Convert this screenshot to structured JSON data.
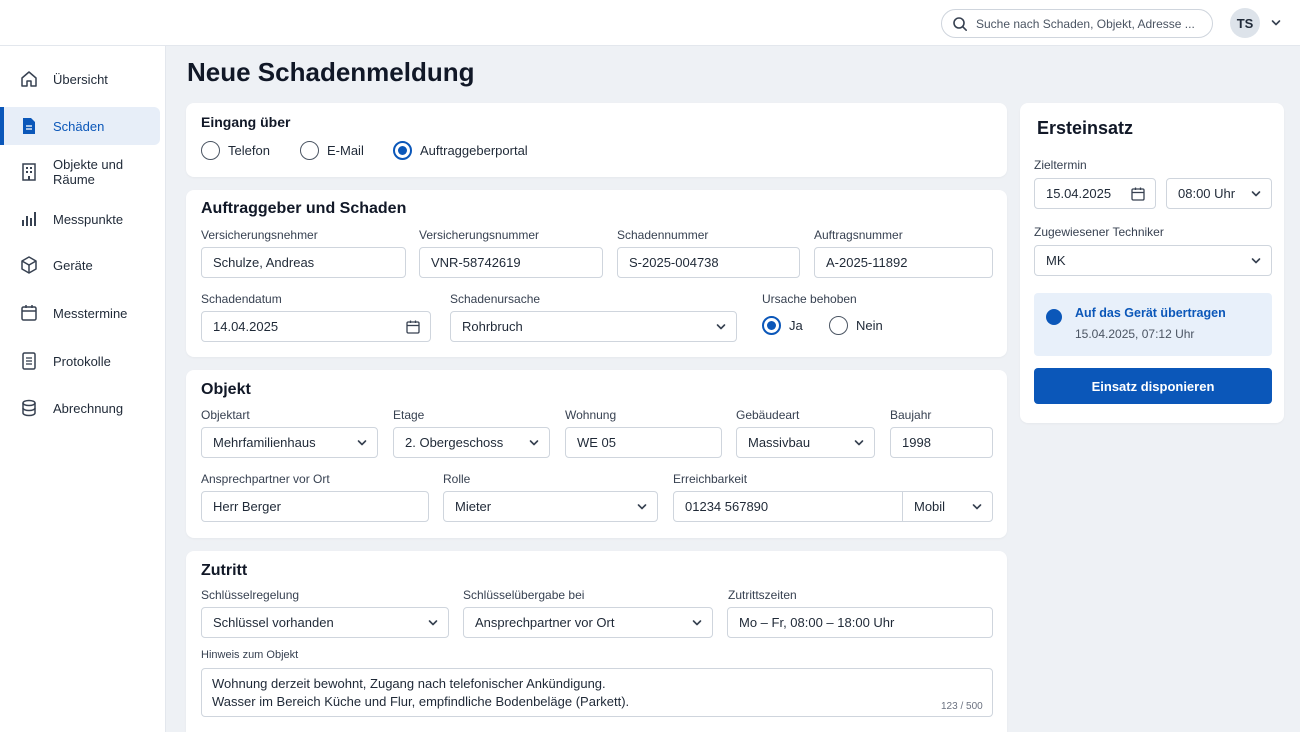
{
  "search": {
    "placeholder": "Suche nach Schaden, Objekt, Adresse ..."
  },
  "user": {
    "initials": "TS"
  },
  "sidebar": {
    "items": [
      {
        "label": "Übersicht",
        "icon": "home-icon"
      },
      {
        "label": "Schäden",
        "icon": "document-icon",
        "active": true
      },
      {
        "label": "Objekte und Räume",
        "icon": "building-icon"
      },
      {
        "label": "Messpunkte",
        "icon": "bar-chart-icon"
      },
      {
        "label": "Geräte",
        "icon": "box-icon"
      },
      {
        "label": "Messtermine",
        "icon": "calendar-icon"
      },
      {
        "label": "Protokolle",
        "icon": "list-document-icon"
      },
      {
        "label": "Abrechnung",
        "icon": "database-icon"
      }
    ]
  },
  "page": {
    "title": "Neue Schadenmeldung"
  },
  "eingang": {
    "title": "Eingang über",
    "options": [
      "Telefon",
      "E-Mail",
      "Auftraggeberportal"
    ],
    "selected": "Auftraggeberportal"
  },
  "auftraggeber": {
    "title": "Auftraggeber und Schaden",
    "versicherungsnehmer": {
      "label": "Versicherungsnehmer",
      "value": "Schulze, Andreas"
    },
    "versicherungsnummer": {
      "label": "Versicherungsnummer",
      "value": "VNR-58742619"
    },
    "schadennummer": {
      "label": "Schadennummer",
      "value": "S-2025-004738"
    },
    "auftragsnummer": {
      "label": "Auftragsnummer",
      "value": "A-2025-11892"
    },
    "schadendatum": {
      "label": "Schadendatum",
      "value": "14.04.2025"
    },
    "schadenursache": {
      "label": "Schadenursache",
      "value": "Rohrbruch"
    },
    "ursache_behoben": {
      "label": "Ursache behoben",
      "options": [
        "Ja",
        "Nein"
      ],
      "selected": "Ja"
    }
  },
  "objekt": {
    "title": "Objekt",
    "objektart": {
      "label": "Objektart",
      "value": "Mehrfamilienhaus"
    },
    "etage": {
      "label": "Etage",
      "value": "2. Obergeschoss"
    },
    "wohnung": {
      "label": "Wohnung",
      "value": "WE 05"
    },
    "gebaeudeart": {
      "label": "Gebäudeart",
      "value": "Massivbau"
    },
    "baujahr": {
      "label": "Baujahr",
      "value": "1998"
    },
    "ansprechpartner": {
      "label": "Ansprechpartner vor Ort",
      "value": "Herr Berger"
    },
    "rolle": {
      "label": "Rolle",
      "value": "Mieter"
    },
    "erreichbarkeit": {
      "label": "Erreichbarkeit",
      "value": "01234 567890",
      "type": "Mobil"
    }
  },
  "zutritt": {
    "title": "Zutritt",
    "schluesselregelung": {
      "label": "Schlüsselregelung",
      "value": "Schlüssel vorhanden"
    },
    "schluesseluebergabe": {
      "label": "Schlüsselübergabe bei",
      "value": "Ansprechpartner vor Ort"
    },
    "zutrittszeiten": {
      "label": "Zutrittszeiten",
      "value": "Mo – Fr, 08:00 – 18:00 Uhr"
    },
    "hinweis": {
      "label": "Hinweis zum Objekt",
      "line1": "Wohnung derzeit bewohnt, Zugang nach telefonischer Ankündigung.",
      "line2": "Wasser im Bereich Küche und Flur, empfindliche Bodenbeläge (Parkett).",
      "counter": "123 / 500"
    }
  },
  "ersteinsatz": {
    "title": "Ersteinsatz",
    "zieltermin": {
      "label": "Zieltermin",
      "date": "15.04.2025",
      "time": "08:00 Uhr"
    },
    "techniker": {
      "label": "Zugewiesener Techniker",
      "value": "MK"
    },
    "notice": {
      "title": "Auf das Gerät übertragen",
      "subtitle": "15.04.2025, 07:12 Uhr"
    },
    "button": "Einsatz disponieren"
  },
  "colors": {
    "accent": "#0b57b9",
    "accent_light": "#e8f0fa",
    "background": "#eef1f5"
  }
}
